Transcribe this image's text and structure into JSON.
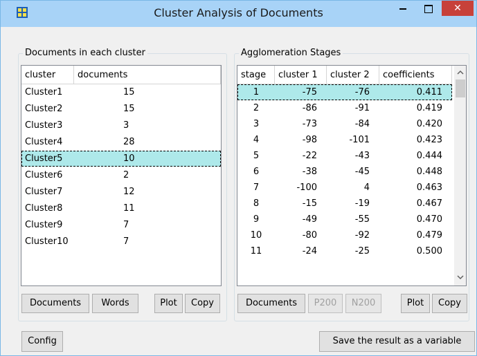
{
  "window": {
    "title": "Cluster Analysis of Documents",
    "close_glyph": "✕"
  },
  "left_panel": {
    "label": "Documents in each cluster",
    "columns": [
      "cluster",
      "documents"
    ],
    "rows": [
      [
        "Cluster1",
        "15"
      ],
      [
        "Cluster2",
        "15"
      ],
      [
        "Cluster3",
        "3"
      ],
      [
        "Cluster4",
        "28"
      ],
      [
        "Cluster5",
        "10"
      ],
      [
        "Cluster6",
        "2"
      ],
      [
        "Cluster7",
        "12"
      ],
      [
        "Cluster8",
        "11"
      ],
      [
        "Cluster9",
        "7"
      ],
      [
        "Cluster10",
        "7"
      ]
    ],
    "selected_index": 4,
    "buttons": {
      "documents": "Documents",
      "words": "Words",
      "plot": "Plot",
      "copy": "Copy"
    }
  },
  "right_panel": {
    "label": "Agglomeration Stages",
    "columns": [
      "stage",
      "cluster 1",
      "cluster 2",
      "coefficients"
    ],
    "rows": [
      [
        "1",
        "-75",
        "-76",
        "0.411"
      ],
      [
        "2",
        "-86",
        "-91",
        "0.419"
      ],
      [
        "3",
        "-73",
        "-84",
        "0.420"
      ],
      [
        "4",
        "-98",
        "-101",
        "0.423"
      ],
      [
        "5",
        "-22",
        "-43",
        "0.444"
      ],
      [
        "6",
        "-38",
        "-45",
        "0.448"
      ],
      [
        "7",
        "-100",
        "4",
        "0.463"
      ],
      [
        "8",
        "-15",
        "-19",
        "0.467"
      ],
      [
        "9",
        "-49",
        "-55",
        "0.470"
      ],
      [
        "10",
        "-80",
        "-92",
        "0.479"
      ],
      [
        "11",
        "-24",
        "-25",
        "0.500"
      ]
    ],
    "selected_index": 0,
    "buttons": {
      "documents": "Documents",
      "p200": "P200",
      "n200": "N200",
      "plot": "Plot",
      "copy": "Copy"
    }
  },
  "footer": {
    "config": "Config",
    "save": "Save the result as a variable"
  },
  "colors": {
    "title_bar": "#a8d3f7",
    "selection": "#aee9ea",
    "close": "#c7413a"
  }
}
